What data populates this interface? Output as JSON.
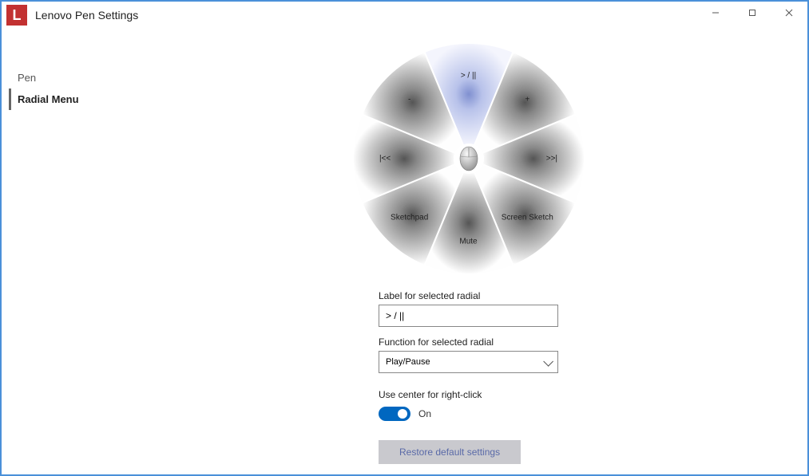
{
  "app": {
    "title": "Lenovo Pen Settings",
    "icon_letter": "L"
  },
  "sidebar": {
    "items": [
      {
        "label": "Pen",
        "active": false
      },
      {
        "label": "Radial Menu",
        "active": true
      }
    ]
  },
  "radial": {
    "segments": [
      {
        "label": "> / ||",
        "selected": true
      },
      {
        "label": "+",
        "selected": false
      },
      {
        "label": ">>|",
        "selected": false
      },
      {
        "label": "Screen Sketch",
        "selected": false
      },
      {
        "label": "Mute",
        "selected": false
      },
      {
        "label": "Sketchpad",
        "selected": false
      },
      {
        "label": "|<<",
        "selected": false
      },
      {
        "label": "-",
        "selected": false
      }
    ]
  },
  "form": {
    "label_field_label": "Label for selected radial",
    "label_value": "> / ||",
    "function_field_label": "Function for selected radial",
    "function_value": "Play/Pause",
    "center_label": "Use center for right-click",
    "toggle_state": "On",
    "restore_label": "Restore default settings"
  },
  "chart_data": {
    "type": "other",
    "description": "8-segment radial menu wheel",
    "selected_index": 0,
    "segments": [
      "> / ||",
      "+",
      ">>|",
      "Screen Sketch",
      "Mute",
      "Sketchpad",
      "|<<",
      "-"
    ]
  }
}
